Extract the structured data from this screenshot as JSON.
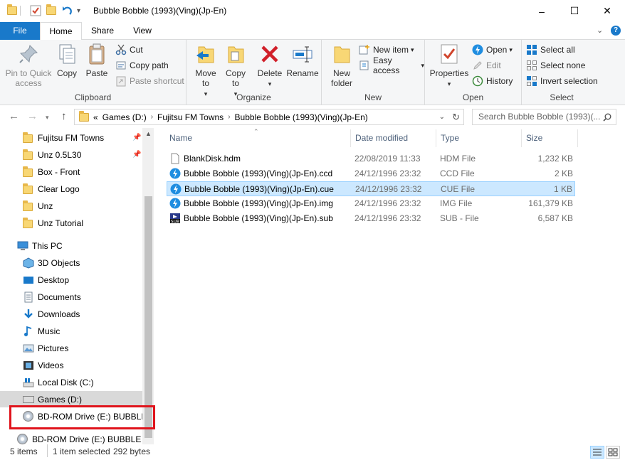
{
  "window": {
    "title": "Bubble Bobble (1993)(Ving)(Jp-En)",
    "minimize": "–",
    "maximize": "☐",
    "close": "✕"
  },
  "tabs": {
    "file": "File",
    "home": "Home",
    "share": "Share",
    "view": "View"
  },
  "ribbon": {
    "clipboard": {
      "label": "Clipboard",
      "pin_to_quick_access": "Pin to Quick access",
      "copy": "Copy",
      "paste": "Paste",
      "cut": "Cut",
      "copy_path": "Copy path",
      "paste_shortcut": "Paste shortcut"
    },
    "organize": {
      "label": "Organize",
      "move_to": "Move to",
      "copy_to": "Copy to",
      "delete": "Delete",
      "rename": "Rename"
    },
    "new": {
      "label": "New",
      "new_folder": "New folder",
      "new_item": "New item",
      "easy_access": "Easy access"
    },
    "open": {
      "label": "Open",
      "properties": "Properties",
      "open": "Open",
      "edit": "Edit",
      "history": "History"
    },
    "select": {
      "label": "Select",
      "select_all": "Select all",
      "select_none": "Select none",
      "invert_selection": "Invert selection"
    }
  },
  "address": {
    "overflow": "«",
    "crumbs": [
      "Games (D:)",
      "Fujitsu FM Towns",
      "Bubble Bobble (1993)(Ving)(Jp-En)"
    ],
    "search_placeholder": "Search Bubble Bobble (1993)(..."
  },
  "nav": {
    "quick_access": [
      "Fujitsu FM Towns",
      "Unz 0.5L30",
      "Box - Front",
      "Clear Logo",
      "Unz",
      "Unz Tutorial"
    ],
    "this_pc": "This PC",
    "pc_items": [
      "3D Objects",
      "Desktop",
      "Documents",
      "Downloads",
      "Music",
      "Pictures",
      "Videos",
      "Local Disk (C:)",
      "Games (D:)",
      "BD-ROM Drive (E:) BUBBLE_"
    ],
    "drive_root": "BD-ROM Drive (E:) BUBBLE B"
  },
  "columns": {
    "name": "Name",
    "date_modified": "Date modified",
    "type": "Type",
    "size": "Size"
  },
  "files": [
    {
      "name": "BlankDisk.hdm",
      "date": "22/08/2019 11:33",
      "type": "HDM File",
      "size": "1,232 KB",
      "icon": "blank-file-icon"
    },
    {
      "name": "Bubble Bobble (1993)(Ving)(Jp-En).ccd",
      "date": "24/12/1996 23:32",
      "type": "CCD File",
      "size": "2 KB",
      "icon": "daemon-tools-icon"
    },
    {
      "name": "Bubble Bobble (1993)(Ving)(Jp-En).cue",
      "date": "24/12/1996 23:32",
      "type": "CUE File",
      "size": "1 KB",
      "icon": "daemon-tools-icon"
    },
    {
      "name": "Bubble Bobble (1993)(Ving)(Jp-En).img",
      "date": "24/12/1996 23:32",
      "type": "IMG File",
      "size": "161,379 KB",
      "icon": "daemon-tools-icon"
    },
    {
      "name": "Bubble Bobble (1993)(Ving)(Jp-En).sub",
      "date": "24/12/1996 23:32",
      "type": "SUB - File",
      "size": "6,587 KB",
      "icon": "sub-file-icon"
    }
  ],
  "status": {
    "items": "5 items",
    "selected": "1 item selected",
    "size": "292 bytes"
  },
  "colors": {
    "accent": "#1979ca",
    "selection": "#cce8ff",
    "highlight_box": "#e0141c"
  }
}
